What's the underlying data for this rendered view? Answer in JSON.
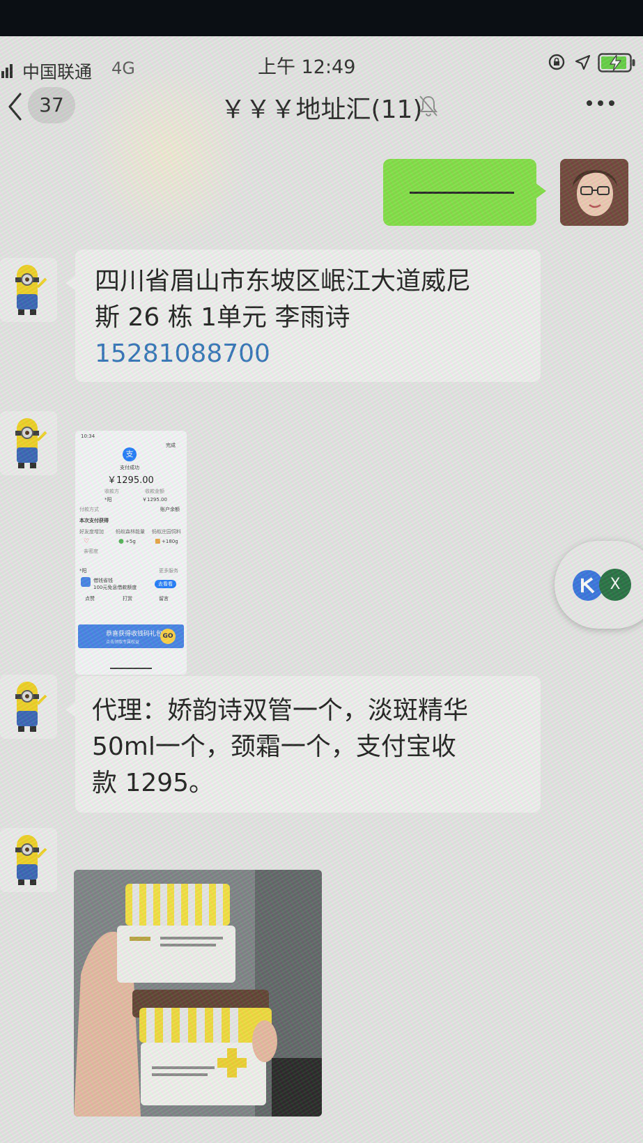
{
  "status_bar": {
    "carrier": "中国联通",
    "network": "4G",
    "time": "上午 12:49"
  },
  "nav": {
    "unread_count": "37",
    "title": "￥￥￥地址汇(11)",
    "muted": true
  },
  "messages": [
    {
      "from": "me",
      "type": "text",
      "text": "————"
    },
    {
      "from": "other",
      "type": "text",
      "lines": [
        "四川省眉山市东坡区岷江大道威尼",
        "斯 26 栋 1单元 李雨诗"
      ],
      "phone": "15281088700"
    },
    {
      "from": "other",
      "type": "image",
      "kind": "payment-screenshot"
    },
    {
      "from": "other",
      "type": "text",
      "lines": [
        "代理：娇韵诗双管一个，淡斑精华",
        "50ml一个，颈霜一个，支付宝收",
        "款 1295。"
      ]
    },
    {
      "from": "other",
      "type": "image",
      "kind": "product-photo"
    }
  ],
  "payment_screenshot": {
    "time": "10:34",
    "done": "完成",
    "status": "支付成功",
    "amount": "￥1295.00",
    "payee_label": "收款方",
    "payee": "*阳",
    "paid_label": "收款金额",
    "paid": "￥1295.00",
    "method_label": "付款方式",
    "method": "账户余额",
    "rewards_title": "本次支付获得",
    "reward_a_label": "好友度增加",
    "reward_b_label": "蚂蚁森林能量",
    "reward_b": "+5g",
    "reward_c_label": "蚂蚁庄园饲料",
    "reward_c": "+180g",
    "reward_a_sub": "亲密度",
    "friend": "*阳",
    "more_services": "更多服务",
    "loan_title": "借钱省钱",
    "loan_desc": "100元免息借款额度",
    "loan_button": "去看看",
    "action_like": "点赞",
    "action_tip": "打赏",
    "action_comment": "留言",
    "banner_text": "恭喜获得收钱码礼包",
    "banner_sub": "点击领取专属权益",
    "banner_go": "GO"
  },
  "floating_widget": {
    "close_label": "X"
  },
  "colors": {
    "my_bubble": "#7fe03f",
    "other_bubble": "#f2f2f2",
    "phone_link": "#2a6fb8",
    "alipay_blue": "#1677ff"
  },
  "icons": [
    "back-chevron-icon",
    "bell-off-icon",
    "more-icon",
    "location-arrow-icon",
    "rotation-lock-icon",
    "battery-charging-icon"
  ]
}
